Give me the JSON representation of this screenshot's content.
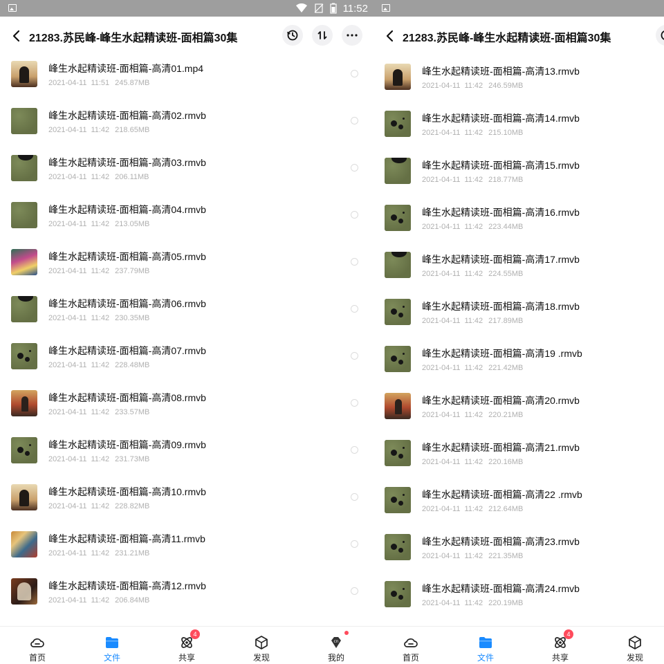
{
  "status": {
    "time": "11:52"
  },
  "header": {
    "title": "21283.苏民峰-峰生水起精读班-面相篇30集"
  },
  "left_files": [
    {
      "name": "峰生水起精读班-面相篇-高清01.mp4",
      "date": "2021-04-11",
      "time": "11:51",
      "size": "245.87MB",
      "thumb": "figure"
    },
    {
      "name": "峰生水起精读班-面相篇-高清02.rmvb",
      "date": "2021-04-11",
      "time": "11:42",
      "size": "218.65MB",
      "thumb": "olive"
    },
    {
      "name": "峰生水起精读班-面相篇-高清03.rmvb",
      "date": "2021-04-11",
      "time": "11:42",
      "size": "206.11MB",
      "thumb": "olive-top"
    },
    {
      "name": "峰生水起精读班-面相篇-高清04.rmvb",
      "date": "2021-04-11",
      "time": "11:42",
      "size": "213.05MB",
      "thumb": "olive"
    },
    {
      "name": "峰生水起精读班-面相篇-高清05.rmvb",
      "date": "2021-04-11",
      "time": "11:42",
      "size": "237.79MB",
      "thumb": "colorful2"
    },
    {
      "name": "峰生水起精读班-面相篇-高清06.rmvb",
      "date": "2021-04-11",
      "time": "11:42",
      "size": "230.35MB",
      "thumb": "olive-top"
    },
    {
      "name": "峰生水起精读班-面相篇-高清07.rmvb",
      "date": "2021-04-11",
      "time": "11:42",
      "size": "228.48MB",
      "thumb": "olive-spots"
    },
    {
      "name": "峰生水起精读班-面相篇-高清08.rmvb",
      "date": "2021-04-11",
      "time": "11:42",
      "size": "233.57MB",
      "thumb": "room"
    },
    {
      "name": "峰生水起精读班-面相篇-高清09.rmvb",
      "date": "2021-04-11",
      "time": "11:42",
      "size": "231.73MB",
      "thumb": "olive-spots"
    },
    {
      "name": "峰生水起精读班-面相篇-高清10.rmvb",
      "date": "2021-04-11",
      "time": "11:42",
      "size": "228.82MB",
      "thumb": "figure"
    },
    {
      "name": "峰生水起精读班-面相篇-高清11.rmvb",
      "date": "2021-04-11",
      "time": "11:42",
      "size": "231.21MB",
      "thumb": "colorful"
    },
    {
      "name": "峰生水起精读班-面相篇-高清12.rmvb",
      "date": "2021-04-11",
      "time": "11:42",
      "size": "206.84MB",
      "thumb": "dark"
    }
  ],
  "right_files": [
    {
      "name": "峰生水起精读班-面相篇-高清13.rmvb",
      "date": "2021-04-11",
      "time": "11:42",
      "size": "246.59MB",
      "thumb": "figure"
    },
    {
      "name": "峰生水起精读班-面相篇-高清14.rmvb",
      "date": "2021-04-11",
      "time": "11:42",
      "size": "215.10MB",
      "thumb": "olive-spots"
    },
    {
      "name": "峰生水起精读班-面相篇-高清15.rmvb",
      "date": "2021-04-11",
      "time": "11:42",
      "size": "218.77MB",
      "thumb": "olive-top"
    },
    {
      "name": "峰生水起精读班-面相篇-高清16.rmvb",
      "date": "2021-04-11",
      "time": "11:42",
      "size": "223.44MB",
      "thumb": "olive-spots"
    },
    {
      "name": "峰生水起精读班-面相篇-高清17.rmvb",
      "date": "2021-04-11",
      "time": "11:42",
      "size": "224.55MB",
      "thumb": "olive-top"
    },
    {
      "name": "峰生水起精读班-面相篇-高清18.rmvb",
      "date": "2021-04-11",
      "time": "11:42",
      "size": "217.89MB",
      "thumb": "olive-spots"
    },
    {
      "name": "峰生水起精读班-面相篇-高清19 .rmvb",
      "date": "2021-04-11",
      "time": "11:42",
      "size": "221.42MB",
      "thumb": "olive-spots"
    },
    {
      "name": "峰生水起精读班-面相篇-高清20.rmvb",
      "date": "2021-04-11",
      "time": "11:42",
      "size": "220.21MB",
      "thumb": "room"
    },
    {
      "name": "峰生水起精读班-面相篇-高清21.rmvb",
      "date": "2021-04-11",
      "time": "11:42",
      "size": "220.16MB",
      "thumb": "olive-spots"
    },
    {
      "name": "峰生水起精读班-面相篇-高清22 .rmvb",
      "date": "2021-04-11",
      "time": "11:42",
      "size": "212.64MB",
      "thumb": "olive-spots"
    },
    {
      "name": "峰生水起精读班-面相篇-高清23.rmvb",
      "date": "2021-04-11",
      "time": "11:42",
      "size": "221.35MB",
      "thumb": "olive-spots"
    },
    {
      "name": "峰生水起精读班-面相篇-高清24.rmvb",
      "date": "2021-04-11",
      "time": "11:42",
      "size": "220.19MB",
      "thumb": "olive-spots"
    }
  ],
  "tabs": [
    {
      "label": "首页",
      "icon": "cloud-icon"
    },
    {
      "label": "文件",
      "icon": "folder-icon",
      "active": true
    },
    {
      "label": "共享",
      "icon": "share-atom-icon",
      "badge": "4"
    },
    {
      "label": "发现",
      "icon": "cube-icon"
    },
    {
      "label": "我的",
      "icon": "diamond-icon",
      "dot": true
    }
  ],
  "colors": {
    "accent": "#1a8bff",
    "badge": "#ff4b5c",
    "meta_text": "#b0b0b0",
    "statusbar": "#9e9e9e"
  }
}
